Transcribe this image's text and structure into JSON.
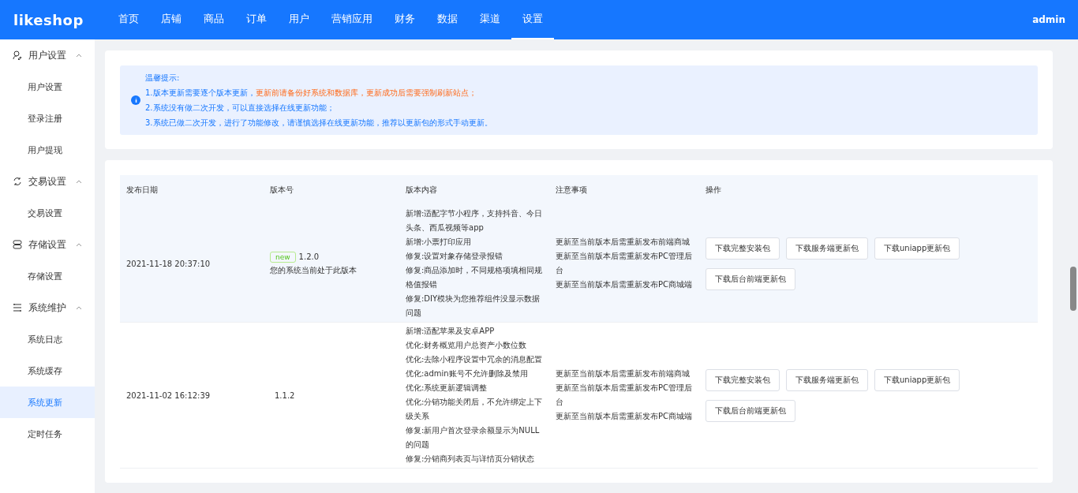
{
  "header": {
    "logo": "likeshop",
    "nav": [
      {
        "label": "首页",
        "selected": false
      },
      {
        "label": "店铺",
        "selected": false
      },
      {
        "label": "商品",
        "selected": false
      },
      {
        "label": "订单",
        "selected": false
      },
      {
        "label": "用户",
        "selected": false
      },
      {
        "label": "营销应用",
        "selected": false
      },
      {
        "label": "财务",
        "selected": false
      },
      {
        "label": "数据",
        "selected": false
      },
      {
        "label": "渠道",
        "selected": false
      },
      {
        "label": "设置",
        "selected": true
      }
    ],
    "user": "admin"
  },
  "sidebar": {
    "groups": [
      {
        "label": "用户设置",
        "expanded": true,
        "items": [
          {
            "label": "用户设置",
            "selected": false
          },
          {
            "label": "登录注册",
            "selected": false
          },
          {
            "label": "用户提现",
            "selected": false
          }
        ]
      },
      {
        "label": "交易设置",
        "expanded": true,
        "items": [
          {
            "label": "交易设置",
            "selected": false
          }
        ]
      },
      {
        "label": "存储设置",
        "expanded": true,
        "items": [
          {
            "label": "存储设置",
            "selected": false
          }
        ]
      },
      {
        "label": "系统维护",
        "expanded": true,
        "items": [
          {
            "label": "系统日志",
            "selected": false
          },
          {
            "label": "系统缓存",
            "selected": false
          },
          {
            "label": "系统更新",
            "selected": true
          },
          {
            "label": "定时任务",
            "selected": false
          }
        ]
      }
    ]
  },
  "notice": {
    "title": "温馨提示:",
    "lines": [
      [
        {
          "text": "1.版本更新需要逐个版本更新，",
          "highlight": false
        },
        {
          "text": "更新前请备份好系统和数据库，更新成功后需要强制刷新站点；",
          "highlight": true
        }
      ],
      [
        {
          "text": "2.系统没有做二次开发，可以直接选择在线更新功能；",
          "highlight": false
        }
      ],
      [
        {
          "text": "3.系统已做二次开发，进行了功能修改，请谨慎选择在线更新功能，推荐以更新包的形式手动更新。",
          "highlight": false
        }
      ]
    ]
  },
  "table": {
    "columns": [
      "发布日期",
      "版本号",
      "版本内容",
      "注意事项",
      "操作"
    ],
    "rows": [
      {
        "date": "2021-11-18 20:37:10",
        "current": true,
        "badge": "new",
        "version": "1.2.0",
        "status": "您的系统当前处于此版本",
        "content": [
          "新增:适配字节小程序，支持抖音、今日头条、西瓜视频等app",
          "新增:小票打印应用",
          "修复:设置对象存储登录报错",
          "修复:商品添加时，不同规格项填相同规格值报错",
          "修复:DIY模块为您推荐组件没显示数据问题"
        ],
        "notes": [
          "更新至当前版本后需重新发布前端商城",
          "更新至当前版本后需重新发布PC管理后台",
          "更新至当前版本后需重新发布PC商城端"
        ],
        "actions": [
          "下载完整安装包",
          "下载服务端更新包",
          "下载uniapp更新包",
          "下载后台前端更新包"
        ]
      },
      {
        "date": "2021-11-02 16:12:39",
        "current": false,
        "version": "1.1.2",
        "content": [
          "新增:适配苹果及安卓APP",
          "优化:财务概览用户总资产小数位数",
          "优化:去除小程序设置中冗余的消息配置",
          "优化:admin账号不允许删除及禁用",
          "优化:系统更新逻辑调整",
          "优化:分销功能关闭后，不允许绑定上下级关系",
          "修复:新用户首次登录余额显示为NULL的问题",
          "修复:分销商列表页与详情页分销状态"
        ],
        "notes": [
          "更新至当前版本后需重新发布前端商城",
          "更新至当前版本后需重新发布PC管理后台",
          "更新至当前版本后需重新发布PC商城端"
        ],
        "actions": [
          "下载完整安装包",
          "下载服务端更新包",
          "下载uniapp更新包",
          "下载后台前端更新包"
        ]
      }
    ]
  }
}
